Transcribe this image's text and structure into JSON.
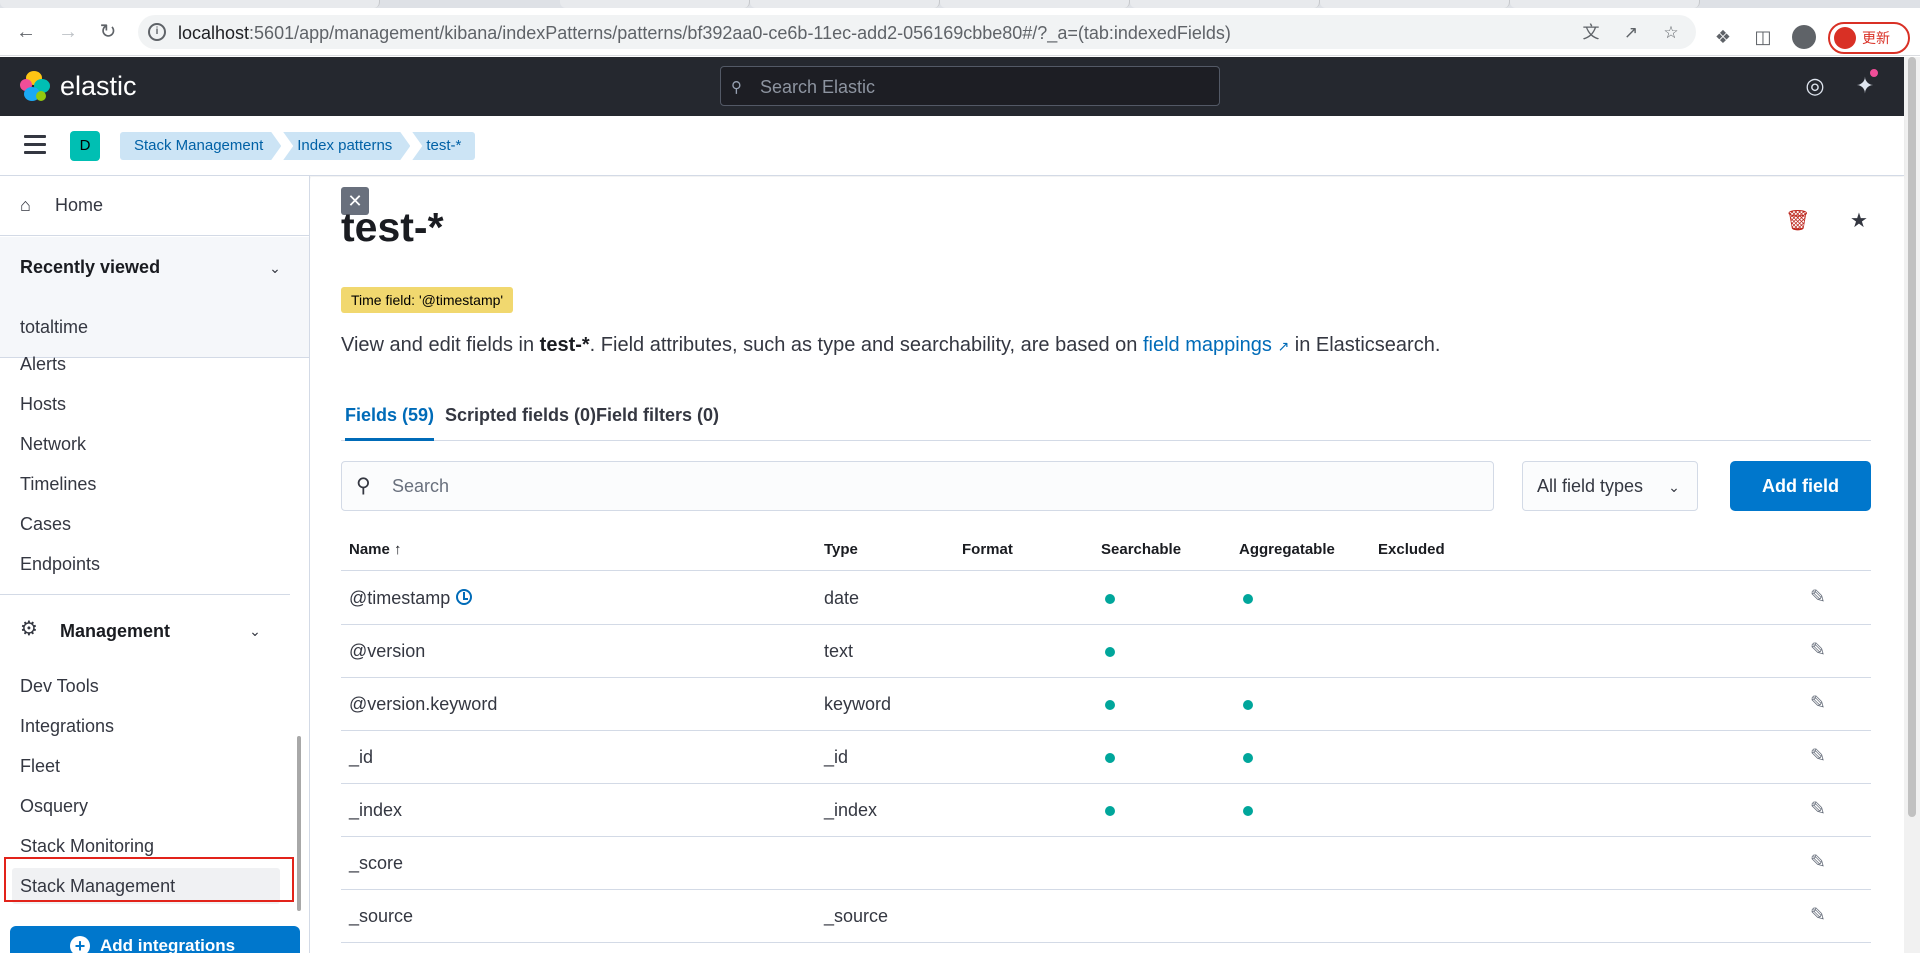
{
  "browser": {
    "url_host": "localhost",
    "url_rest": ":5601/app/management/kibana/indexPatterns/patterns/bf392aa0-ce6b-11ec-add2-056169cbbe80#/?_a=(tab:indexedFields)",
    "update_label": "更新"
  },
  "header": {
    "brand": "elastic",
    "search_placeholder": "Search Elastic"
  },
  "breadcrumbs": {
    "space_initial": "D",
    "items": [
      "Stack Management",
      "Index patterns",
      "test-*"
    ]
  },
  "sidebar": {
    "home": "Home",
    "recently_viewed_title": "Recently viewed",
    "recent_items": [
      "totaltime"
    ],
    "security_items": [
      "Alerts",
      "Hosts",
      "Network",
      "Timelines",
      "Cases",
      "Endpoints"
    ],
    "management_title": "Management",
    "management_items": [
      "Dev Tools",
      "Integrations",
      "Fleet",
      "Osquery",
      "Stack Monitoring",
      "Stack Management"
    ],
    "add_integrations": "Add integrations"
  },
  "main": {
    "title": "test-*",
    "time_badge": "Time field: '@timestamp'",
    "desc_prefix": "View and edit fields in ",
    "desc_bold": "test-*",
    "desc_middle": ". Field attributes, such as type and searchability, are based on ",
    "desc_link": "field mappings",
    "desc_suffix": " in Elasticsearch.",
    "tabs": [
      "Fields (59)",
      "Scripted fields (0)",
      "Field filters (0)"
    ],
    "search_placeholder": "Search",
    "field_types_label": "All field types",
    "add_field_label": "Add field",
    "columns": [
      "Name",
      "Type",
      "Format",
      "Searchable",
      "Aggregatable",
      "Excluded"
    ],
    "rows": [
      {
        "name": "@timestamp",
        "type": "date",
        "format": "",
        "searchable": true,
        "aggregatable": true,
        "excluded": false,
        "time": true
      },
      {
        "name": "@version",
        "type": "text",
        "format": "",
        "searchable": true,
        "aggregatable": false,
        "excluded": false
      },
      {
        "name": "@version.keyword",
        "type": "keyword",
        "format": "",
        "searchable": true,
        "aggregatable": true,
        "excluded": false
      },
      {
        "name": "_id",
        "type": "_id",
        "format": "",
        "searchable": true,
        "aggregatable": true,
        "excluded": false
      },
      {
        "name": "_index",
        "type": "_index",
        "format": "",
        "searchable": true,
        "aggregatable": true,
        "excluded": false
      },
      {
        "name": "_score",
        "type": "",
        "format": "",
        "searchable": false,
        "aggregatable": false,
        "excluded": false
      },
      {
        "name": "_source",
        "type": "_source",
        "format": "",
        "searchable": false,
        "aggregatable": false,
        "excluded": false
      }
    ]
  },
  "colors": {
    "header_bg": "#25282f",
    "accent": "#0077cc",
    "link": "#006bb8",
    "badge": "#f1d86f",
    "dot": "#00a69b",
    "highlight": "#e2231a"
  }
}
